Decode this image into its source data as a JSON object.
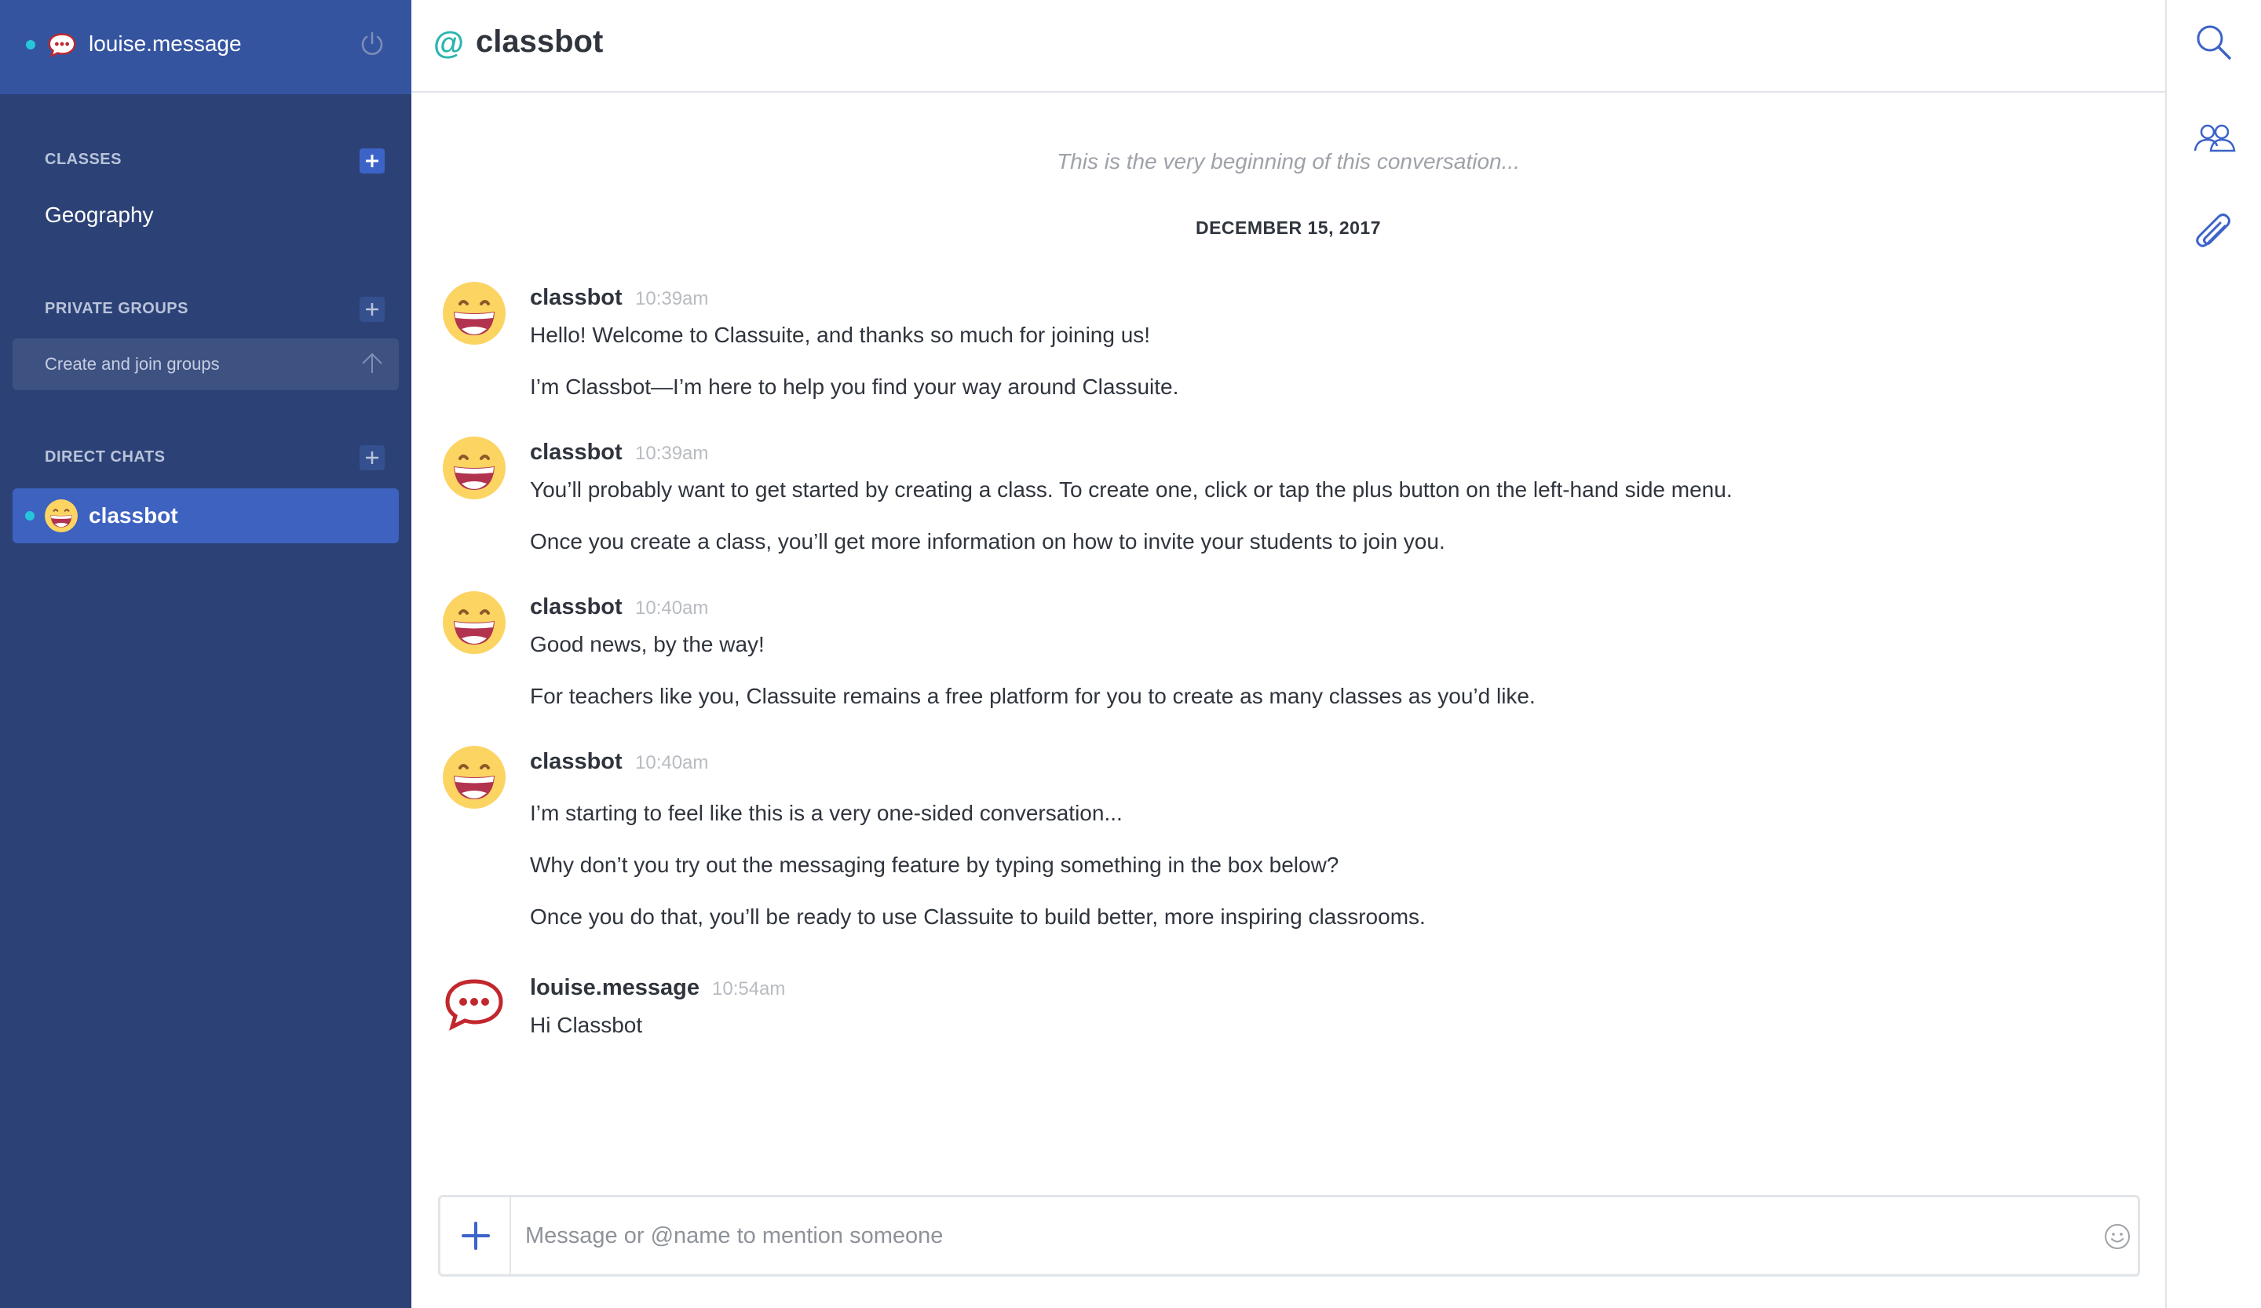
{
  "colors": {
    "sidebar_bg": "#2c4276",
    "sidebar_header_bg": "#3554a0",
    "active_item_bg": "#3d62c0",
    "status_online": "#26c6da",
    "accent_blue": "#3c63c8",
    "mention_teal": "#2ab5ae",
    "text_dark": "#2f343d",
    "text_muted": "#9ea2a8"
  },
  "sidebar": {
    "username": "louise.message",
    "user_icon": "rocket-chat-logo-icon",
    "power_icon": "power-icon",
    "sections": {
      "classes": {
        "title": "CLASSES",
        "items": [
          "Geography"
        ]
      },
      "private_groups": {
        "title": "PRIVATE GROUPS",
        "prompt": "Create and join groups"
      },
      "direct_chats": {
        "title": "DIRECT CHATS",
        "items": [
          {
            "name": "classbot",
            "icon": "grinning-face-icon",
            "active": true
          }
        ]
      }
    }
  },
  "room": {
    "prefix": "@",
    "name": "classbot",
    "conversation_start": "This is the very beginning of this conversation...",
    "date_separator": "DECEMBER 15, 2017"
  },
  "messages": [
    {
      "user": "classbot",
      "time": "10:39am",
      "avatar": "grinning-face-icon",
      "lines": [
        "Hello! Welcome to Classuite, and thanks so much for joining us!",
        "I’m Classbot—I’m here to help you find your way around Classuite."
      ]
    },
    {
      "user": "classbot",
      "time": "10:39am",
      "avatar": "grinning-face-icon",
      "lines": [
        "You’ll probably want to get started by creating a class. To create one, click or tap the plus button on the left-hand side menu.",
        "Once you create a class, you’ll get more information on how to invite your students to join you."
      ]
    },
    {
      "user": "classbot",
      "time": "10:40am",
      "avatar": "grinning-face-icon",
      "lines": [
        "Good news, by the way!",
        "For teachers like you, Classuite remains a free platform for you to create as many classes as you’d like."
      ]
    },
    {
      "user": "classbot",
      "time": "10:40am",
      "avatar": "grinning-face-icon",
      "lines": [
        "I’m starting to feel like this is a very one-sided conversation...",
        "Why don’t you try out the messaging feature by typing something in the box below?",
        "Once you do that, you’ll be ready to use Classuite to build better, more inspiring classrooms."
      ]
    },
    {
      "user": "louise.message",
      "time": "10:54am",
      "avatar": "rocket-chat-logo-icon",
      "lines": [
        "Hi Classbot"
      ]
    }
  ],
  "composer": {
    "placeholder": "Message or @name to mention someone",
    "value": "",
    "plus_icon": "plus-icon",
    "emoji_icon": "smiley-icon"
  },
  "rail": {
    "icons": [
      "search-icon",
      "members-icon",
      "paperclip-icon"
    ]
  }
}
